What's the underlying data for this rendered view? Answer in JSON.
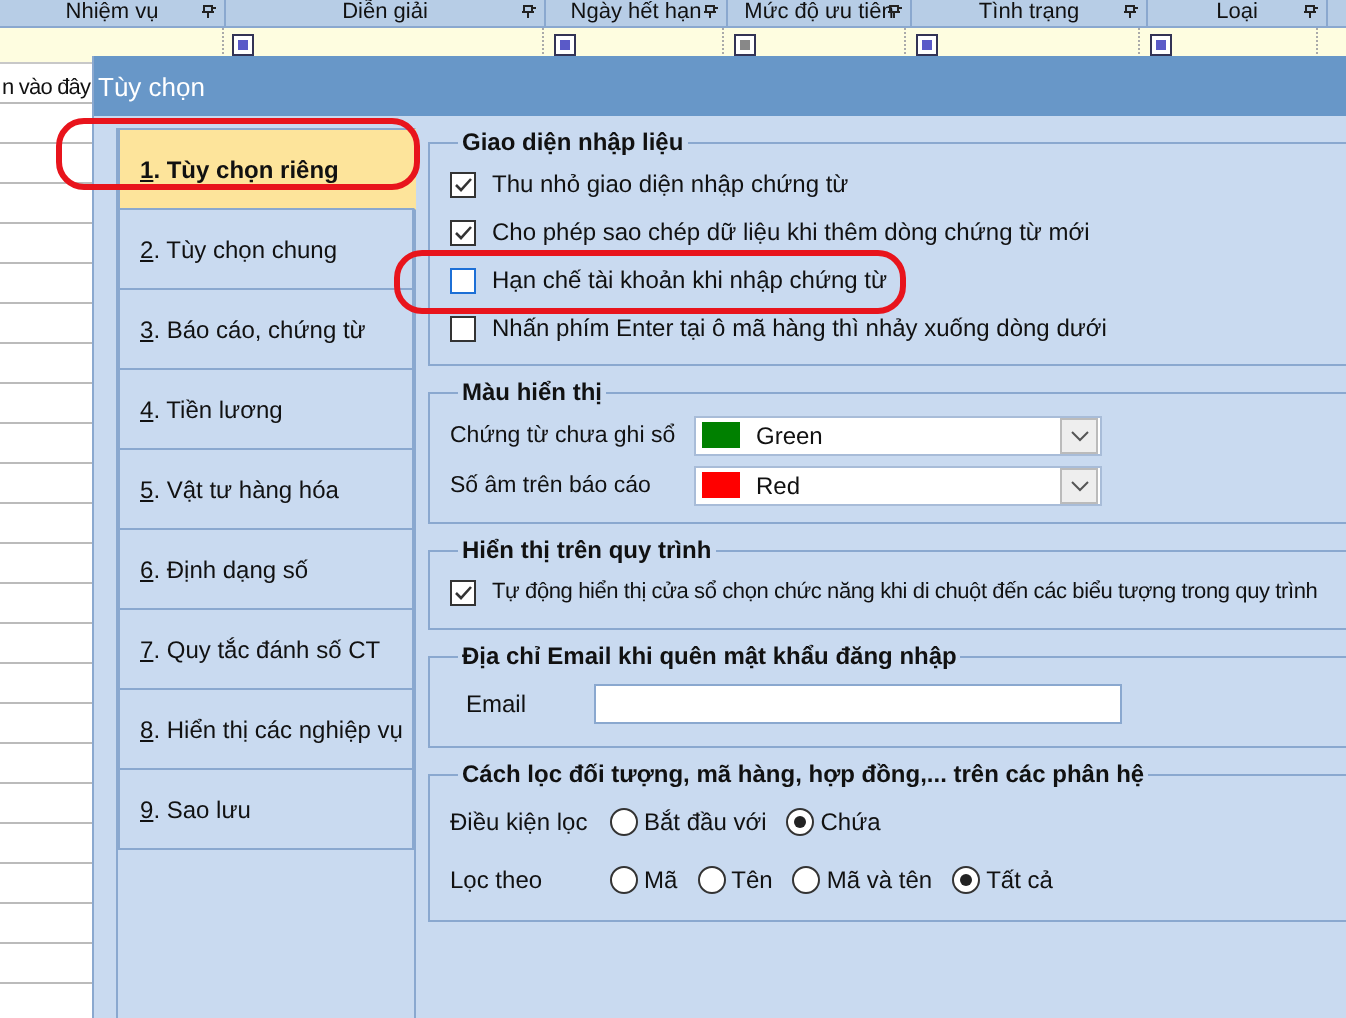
{
  "background_grid": {
    "columns": [
      {
        "label": "Nhiệm vụ"
      },
      {
        "label": "Diễn giải",
        "filter_disabled": false
      },
      {
        "label": "Ngày hết hạn",
        "filter_disabled": false
      },
      {
        "label": "Mức độ ưu tiên",
        "filter_disabled": true
      },
      {
        "label": "Tình trạng",
        "filter_disabled": false
      },
      {
        "label": "Loại",
        "filter_disabled": false
      }
    ],
    "side_text": "n vào đây"
  },
  "window": {
    "title": "Tùy chọn"
  },
  "nav": {
    "items": [
      {
        "key": "1",
        "label": ". Tùy chọn riêng",
        "selected": true,
        "annotated": true
      },
      {
        "key": "2",
        "label": ". Tùy chọn chung",
        "selected": false
      },
      {
        "key": "3",
        "label": ". Báo cáo, chứng từ",
        "selected": false
      },
      {
        "key": "4",
        "label": ". Tiền lương",
        "selected": false
      },
      {
        "key": "5",
        "label": ". Vật tư hàng hóa",
        "selected": false
      },
      {
        "key": "6",
        "label": ". Định dạng số",
        "selected": false
      },
      {
        "key": "7",
        "label": ". Quy tắc đánh số CT",
        "selected": false
      },
      {
        "key": "8",
        "label": ". Hiển thị các nghiệp vụ",
        "selected": false
      },
      {
        "key": "9",
        "label": ". Sao lưu",
        "selected": false
      }
    ]
  },
  "groups": [
    {
      "kind": "checkboxes",
      "title": "Giao diện nhập liệu",
      "items": [
        {
          "label": "Thu nhỏ giao diện nhập chứng từ",
          "checked": true
        },
        {
          "label": "Cho phép sao chép dữ liệu khi thêm dòng chứng từ mới",
          "checked": true
        },
        {
          "label": "Hạn chế tài khoản khi nhập chứng từ",
          "checked": false,
          "annotated": true
        },
        {
          "label": "Nhấn phím Enter tại ô mã hàng thì nhảy xuống dòng dưới",
          "checked": false
        }
      ]
    },
    {
      "kind": "colors",
      "title": "Màu hiển thị",
      "items": [
        {
          "label": "Chứng từ chưa ghi sổ",
          "value": "Green",
          "color": "#008000"
        },
        {
          "label": "Số âm trên báo cáo",
          "value": "Red",
          "color": "#ff0000"
        }
      ]
    },
    {
      "kind": "checkboxes",
      "title": "Hiển thị trên quy trình",
      "items": [
        {
          "label": "Tự động hiển thị cửa sổ chọn chức năng khi di chuột đến các biểu tượng trong quy trình",
          "checked": true
        }
      ]
    },
    {
      "kind": "fields",
      "title": "Địa chỉ Email khi quên mật khẩu đăng nhập",
      "items": [
        {
          "label": "Email"
        }
      ]
    },
    {
      "kind": "radios",
      "title": "Cách lọc đối tượng, mã hàng, hợp đồng,... trên các phân hệ",
      "items": [
        {
          "label": "Điều kiện lọc",
          "options": [
            {
              "label": "Bắt đầu với",
              "selected": false
            },
            {
              "label": "Chứa",
              "selected": true
            }
          ]
        },
        {
          "label": "Lọc theo",
          "options": [
            {
              "label": "Mã",
              "selected": false
            },
            {
              "label": "Tên",
              "selected": false
            },
            {
              "label": "Mã và tên",
              "selected": false
            },
            {
              "label": "Tất cả",
              "selected": true
            }
          ]
        }
      ]
    }
  ]
}
